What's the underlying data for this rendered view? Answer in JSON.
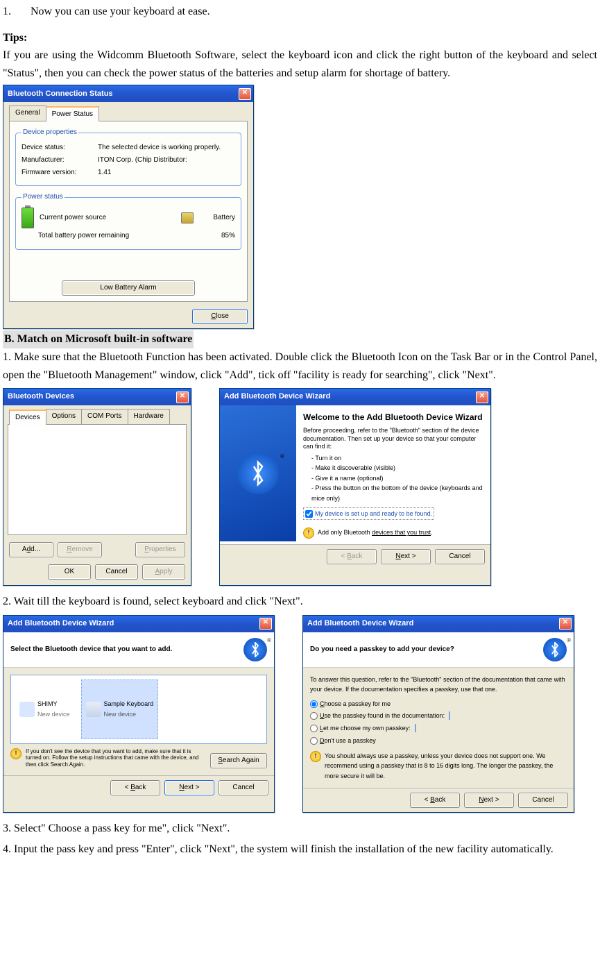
{
  "step_top": {
    "num": "1.",
    "text": "Now you can use your keyboard at ease."
  },
  "tips_head": "Tips:",
  "tips_para": "If you are using the Widcomm Bluetooth Software, select the keyboard icon and click the right button of the keyboard and select \"Status\", then you can check the power status of the batteries and setup alarm for shortage of battery.",
  "dlg1": {
    "title": "Bluetooth Connection Status",
    "tabs": {
      "general": "General",
      "power": "Power Status"
    },
    "grp1": {
      "legend": "Device properties",
      "status_k": "Device status:",
      "status_v": "The selected device is working properly.",
      "manu_k": "Manufacturer:",
      "manu_v": "ITON Corp. (Chip Distributor:",
      "fw_k": "Firmware version:",
      "fw_v": "1.41"
    },
    "grp2": {
      "legend": "Power status",
      "src_k": "Current power source",
      "src_v": "Battery",
      "rem_k": "Total battery power remaining",
      "rem_v": "85%"
    },
    "lba": "Low Battery Alarm",
    "close": "Close"
  },
  "section_b": "B. Match on Microsoft built-in software",
  "para_b1": "1. Make sure that the Bluetooth Function has been activated. Double click the Bluetooth Icon on the Task Bar or in the Control Panel, open the \"Bluetooth Management\" window, click \"Add\", tick off \"facility is ready for searching\", click \"Next\".",
  "dlg2": {
    "title": "Bluetooth Devices",
    "tabs": {
      "devices": "Devices",
      "options": "Options",
      "com": "COM Ports",
      "hw": "Hardware"
    },
    "add": "Add...",
    "remove": "Remove",
    "props": "Properties",
    "ok": "OK",
    "cancel": "Cancel",
    "apply": "Apply"
  },
  "dlg_wiz1": {
    "title": "Add Bluetooth Device Wizard",
    "heading": "Welcome to the Add Bluetooth Device Wizard",
    "p1": "Before proceeding, refer to the \"Bluetooth\" section of the device documentation. Then set up your device so that your computer can find it:",
    "li1": "Turn it on",
    "li2": "Make it discoverable (visible)",
    "li3": "Give it a name (optional)",
    "li4": "Press the button on the bottom of the device (keyboards and mice only)",
    "chk": "My device is set up and ready to be found.",
    "warn": "Add only Bluetooth devices that you trust.",
    "back": "< Back",
    "next": "Next >",
    "cancel": "Cancel"
  },
  "para_b2": "2. Wait till the keyboard is found, select keyboard and click \"Next\".",
  "dlg_wiz2": {
    "title": "Add Bluetooth Device Wizard",
    "head": "Select the Bluetooth device that you want to add.",
    "dev1_name": "SHIMY",
    "dev1_sub": "New device",
    "dev2_name": "Sample Keyboard",
    "dev2_sub": "New device",
    "warn": "If you don't see the device that you want to add, make sure that it is turned on. Follow the setup instructions that came with the device, and then click Search Again.",
    "search": "Search Again",
    "back": "< Back",
    "next": "Next >",
    "cancel": "Cancel"
  },
  "dlg_wiz3": {
    "title": "Add Bluetooth Device Wizard",
    "head": "Do you need a passkey to add your device?",
    "p1": "To answer this question, refer to the \"Bluetooth\" section of the documentation that came with your device. If the documentation specifies a passkey, use that one.",
    "r1": "Choose a passkey for me",
    "r2": "Use the passkey found in the documentation:",
    "r3": "Let me choose my own passkey:",
    "r4": "Don't use a passkey",
    "warn": "You should always use a passkey, unless your device does not support one. We recommend using a passkey that is 8 to 16 digits long. The longer the passkey, the more secure it will be.",
    "back": "< Back",
    "next": "Next >",
    "cancel": "Cancel"
  },
  "para_b3": "3. Select\" Choose a pass key for me\", click \"Next\".",
  "para_b4": "4. Input the pass key and press \"Enter\", click \"Next\", the system will finish the installation of the new facility automatically."
}
